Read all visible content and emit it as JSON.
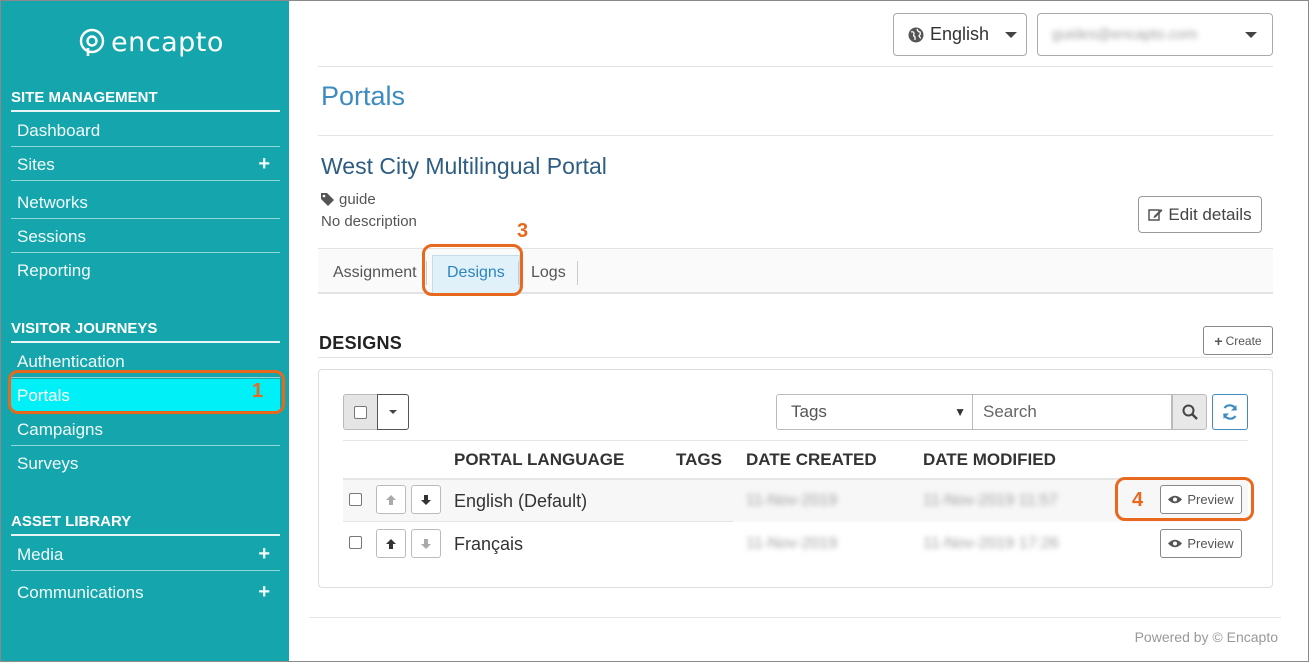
{
  "app": {
    "logo_text": "encapto"
  },
  "sidebar": {
    "site_management": {
      "heading": "SITE MANAGEMENT",
      "items": [
        {
          "label": "Dashboard",
          "expandable": false
        },
        {
          "label": "Sites",
          "expandable": true,
          "expand_symbol": "+"
        },
        {
          "label": "Networks",
          "expandable": false
        },
        {
          "label": "Sessions",
          "expandable": false
        },
        {
          "label": "Reporting",
          "expandable": false
        }
      ]
    },
    "visitor_journeys": {
      "heading": "VISITOR JOURNEYS",
      "items": [
        {
          "label": "Authentication"
        },
        {
          "label": "Portals",
          "active": true
        },
        {
          "label": "Campaigns"
        },
        {
          "label": "Surveys"
        }
      ]
    },
    "asset_library": {
      "heading": "ASSET LIBRARY",
      "items": [
        {
          "label": "Media",
          "expand_symbol": "+"
        },
        {
          "label": "Communications",
          "expand_symbol": "+"
        }
      ]
    }
  },
  "header": {
    "language": "English",
    "user_email": "guides@encapto.com"
  },
  "page": {
    "title": "Portals",
    "portal_name": "West City Multilingual Portal",
    "tag": "guide",
    "description": "No description",
    "edit_label": "Edit details"
  },
  "tabs": [
    {
      "label": "Assignment"
    },
    {
      "label": "Designs",
      "active": true
    },
    {
      "label": "Logs"
    }
  ],
  "designs": {
    "heading": "DESIGNS",
    "create_label": "Create",
    "tags_filter": "Tags",
    "search_placeholder": "Search",
    "columns": [
      "PORTAL LANGUAGE",
      "TAGS",
      "DATE CREATED",
      "DATE MODIFIED"
    ],
    "rows": [
      {
        "language": "English (Default)",
        "tags": "",
        "created": "11-Nov-2019",
        "modified": "11-Nov-2019 11:57",
        "preview_label": "Preview"
      },
      {
        "language": "Français",
        "tags": "",
        "created": "11-Nov-2019",
        "modified": "11-Nov-2019 17:26",
        "preview_label": "Preview"
      }
    ]
  },
  "annotations": {
    "step1": "1",
    "step3": "3",
    "step4": "4"
  },
  "footer": {
    "text": "Powered by © Encapto"
  },
  "colors": {
    "sidebar_bg": "#14a6ac",
    "active_item": "#00f0f8",
    "callout": "#e8681e",
    "link_blue": "#3d8bbf"
  }
}
